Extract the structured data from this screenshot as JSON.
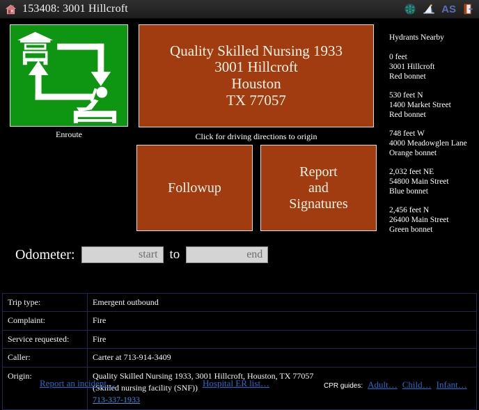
{
  "titlebar": {
    "home_icon": "house-icon",
    "title": "153408: 3001 Hillcroft",
    "actions": [
      {
        "name": "globe-icon",
        "label": ""
      },
      {
        "name": "satellite-icon",
        "label": ""
      },
      {
        "name": "as-button",
        "label": "AS"
      },
      {
        "name": "exit-door-icon",
        "label": ""
      }
    ]
  },
  "status_tile": {
    "label": "Enroute",
    "color": "#0E9612",
    "icon": "ambulance-station-to-patient-icon"
  },
  "origin_button": {
    "lines": [
      "Quality Skilled Nursing 1933",
      "3001 Hillcroft",
      "Houston",
      "TX 77057"
    ],
    "text": "Quality Skilled Nursing 1933\n3001 Hillcroft\nHouston\nTX 77057",
    "caption": "Click for driving directions to origin",
    "color": "#A03C10"
  },
  "actions": {
    "followup": "Followup",
    "report": "Report\nand\nSignatures"
  },
  "hydrants": {
    "title": "Hydrants Nearby",
    "items": [
      {
        "distance": "0 feet",
        "address": "3001 Hillcroft",
        "bonnet": "Red bonnet"
      },
      {
        "distance": "530 feet N",
        "address": "1400 Market Street",
        "bonnet": "Red bonnet"
      },
      {
        "distance": "748 feet W",
        "address": "4000 Meadowglen Lane",
        "bonnet": "Orange bonnet"
      },
      {
        "distance": "2,032 feet NE",
        "address": "54800 Main Street",
        "bonnet": "Blue bonnet"
      },
      {
        "distance": "2,456 feet N",
        "address": "26400 Main Street",
        "bonnet": "Green bonnet"
      }
    ]
  },
  "odometer": {
    "label": "Odometer:",
    "separator": "to",
    "start_value": "",
    "start_placeholder": "start",
    "end_value": "",
    "end_placeholder": "end"
  },
  "details": {
    "rows": [
      {
        "key": "Trip type:",
        "value": "Emergent outbound"
      },
      {
        "key": "Complaint:",
        "value": "Fire"
      },
      {
        "key": "Service requested:",
        "value": "Fire"
      },
      {
        "key": "Caller:",
        "value": "Carter at 713-914-3409"
      }
    ],
    "origin": {
      "key": "Origin:",
      "line1": "Quality Skilled Nursing 1933, 3001 Hillcroft, Houston, TX 77057",
      "line2": "(Skilled nursing facility (SNF))",
      "phone": "713-337-1933"
    }
  },
  "footer": {
    "report_incident": "Report an incident…",
    "hospital_er": "Hospital ER list…",
    "cpr_label": "CPR guides:",
    "cpr_adult": "Adult…",
    "cpr_child": "Child…",
    "cpr_infant": "Infant…"
  }
}
